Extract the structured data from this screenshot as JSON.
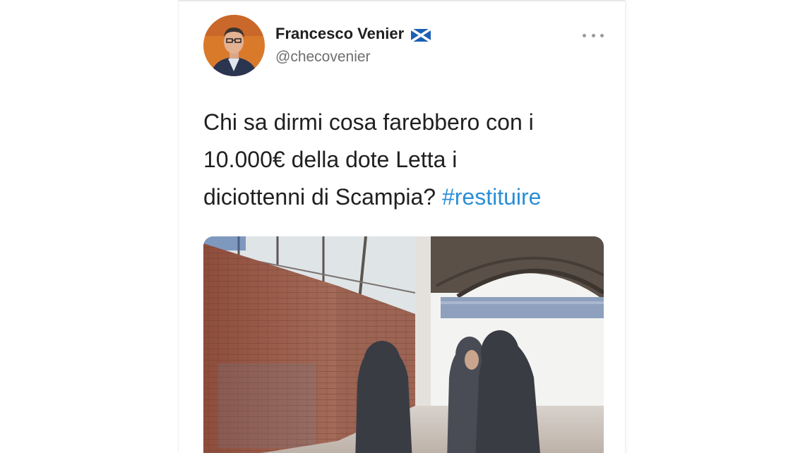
{
  "tweet": {
    "author_name": "Francesco Venier",
    "author_handle": "@checovenier",
    "flag_icon": "scotland-flag-icon",
    "more_icon": "more-options-icon",
    "text_lines": [
      "Chi sa dirmi cosa farebbero con i",
      "10.000€ della dote Letta i",
      "diciottenni di Scampia?"
    ],
    "hashtag": "#restituire",
    "colors": {
      "hashtag": "#2a8fd6",
      "name": "#1e1e1e",
      "handle": "#6e6e6e",
      "flag": "#1d5fb4"
    },
    "media_description_icon": "photo-hooded-youths-warehouse"
  }
}
